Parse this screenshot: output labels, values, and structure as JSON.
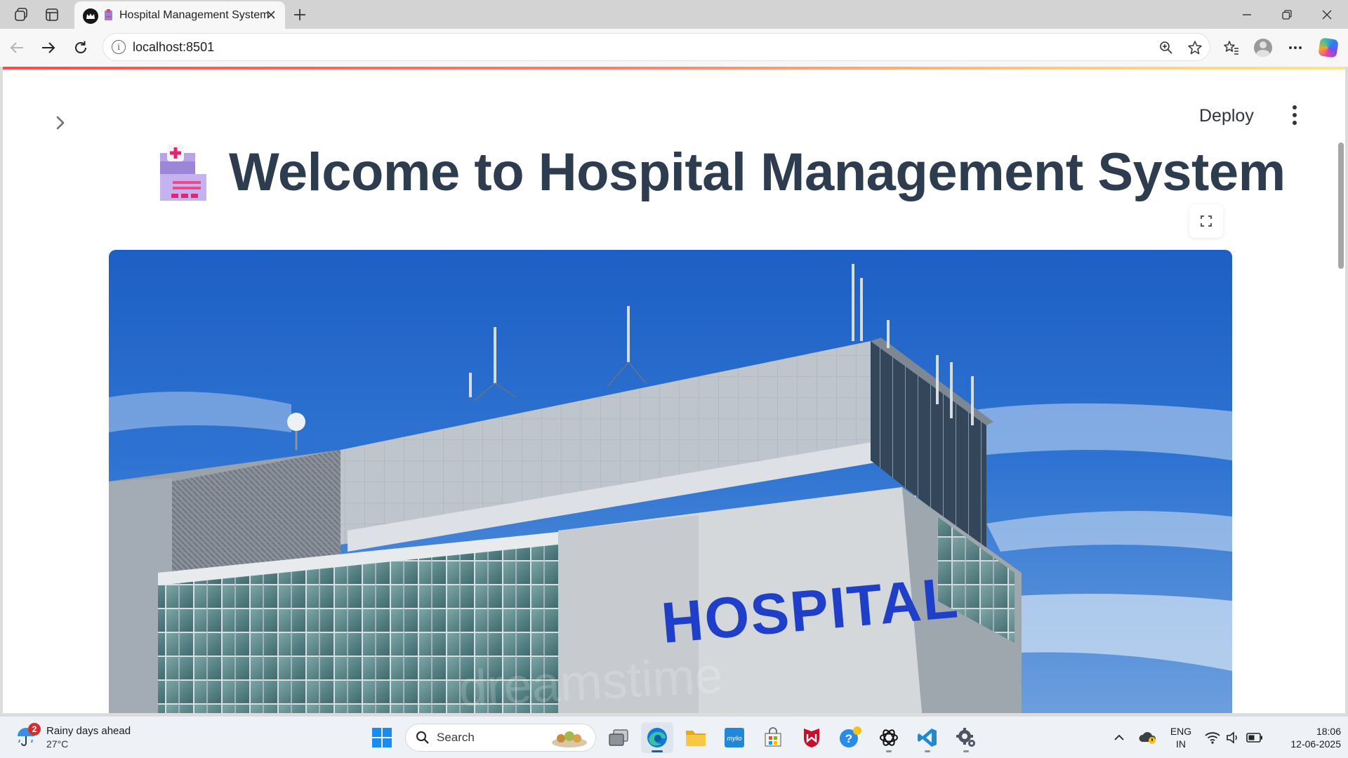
{
  "browser": {
    "tab": {
      "title": "Hospital Management System"
    },
    "address_bar": {
      "url": "localhost:8501"
    }
  },
  "app": {
    "deploy_label": "Deploy",
    "title": "Welcome to Hospital Management System",
    "title_emoji": "hospital-emoji",
    "hero_image": {
      "sign_text": "HOSPITAL",
      "watermark": "dreamstime"
    },
    "accent_colors": {
      "top_line_start": "#ff4b4b",
      "top_line_end": "#ffe58a",
      "title": "#2e3c50"
    }
  },
  "taskbar": {
    "weather": {
      "badge": "2",
      "title": "Rainy days ahead",
      "temp": "27°C"
    },
    "search": {
      "placeholder": "Search"
    },
    "pinned_apps": [
      "start-icon",
      "search",
      "task-view-icon",
      "edge-icon",
      "file-explorer-icon",
      "mylio-icon",
      "microsoft-store-icon",
      "mcafee-icon",
      "get-help-icon",
      "chatgpt-icon",
      "vscode-icon",
      "settings-icon"
    ],
    "tray": {
      "lang_line1": "ENG",
      "lang_line2": "IN",
      "time": "18:06",
      "date": "12-06-2025"
    }
  }
}
